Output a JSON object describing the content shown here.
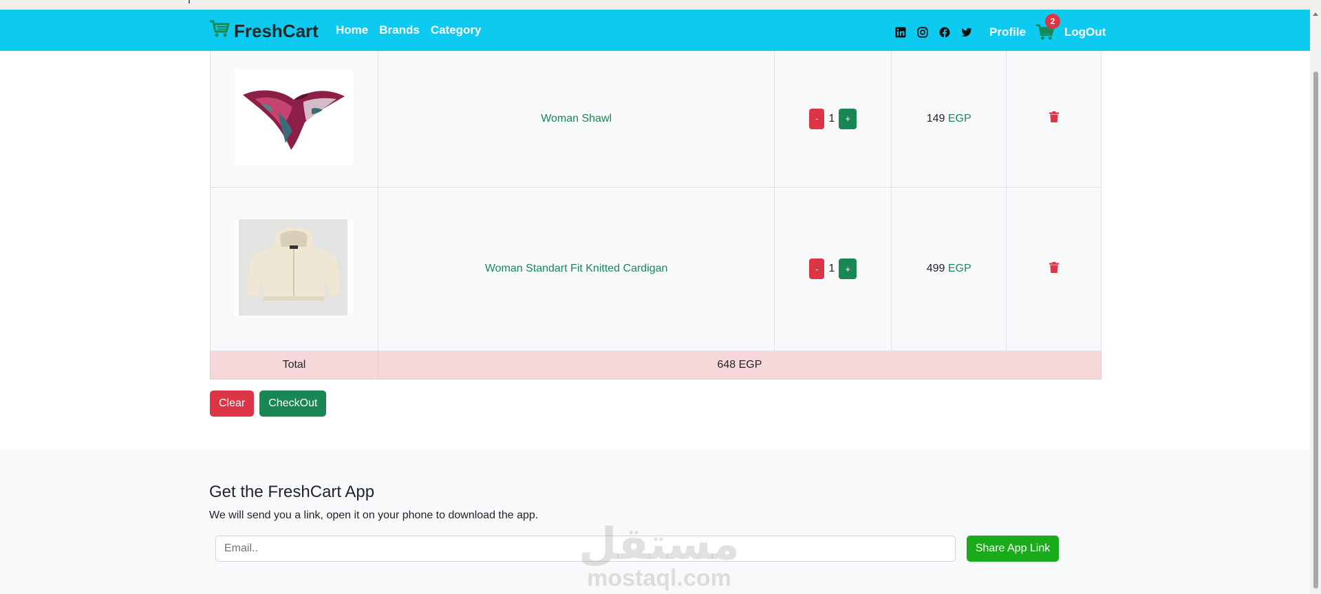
{
  "navbar": {
    "brand": "FreshCart",
    "links": [
      "Home",
      "Brands",
      "Category"
    ],
    "socials": [
      "linkedin-icon",
      "instagram-icon",
      "facebook-icon",
      "twitter-icon"
    ],
    "profile": "Profile",
    "cart_count": "2",
    "logout": "LogOut",
    "bg_color": "#0dcaf0",
    "brand_icon_color": "#198754"
  },
  "cart": {
    "items": [
      {
        "name": "Woman Shawl",
        "quantity": "1",
        "price": "149",
        "currency": "EGP",
        "minus": "-",
        "plus": "+"
      },
      {
        "name": "Woman Standart Fit Knitted Cardigan",
        "quantity": "1",
        "price": "499",
        "currency": "EGP",
        "minus": "-",
        "plus": "+"
      }
    ],
    "total_label": "Total",
    "total_value": "648 EGP"
  },
  "actions": {
    "clear": "Clear",
    "checkout": "CheckOut"
  },
  "footer": {
    "title": "Get the FreshCart App",
    "subtitle": "We will send you a link, open it on your phone to download the app.",
    "email_placeholder": "Email..",
    "share_button": "Share App Link"
  },
  "watermark": {
    "arabic": "مستقل",
    "latin": "mostaql.com"
  }
}
